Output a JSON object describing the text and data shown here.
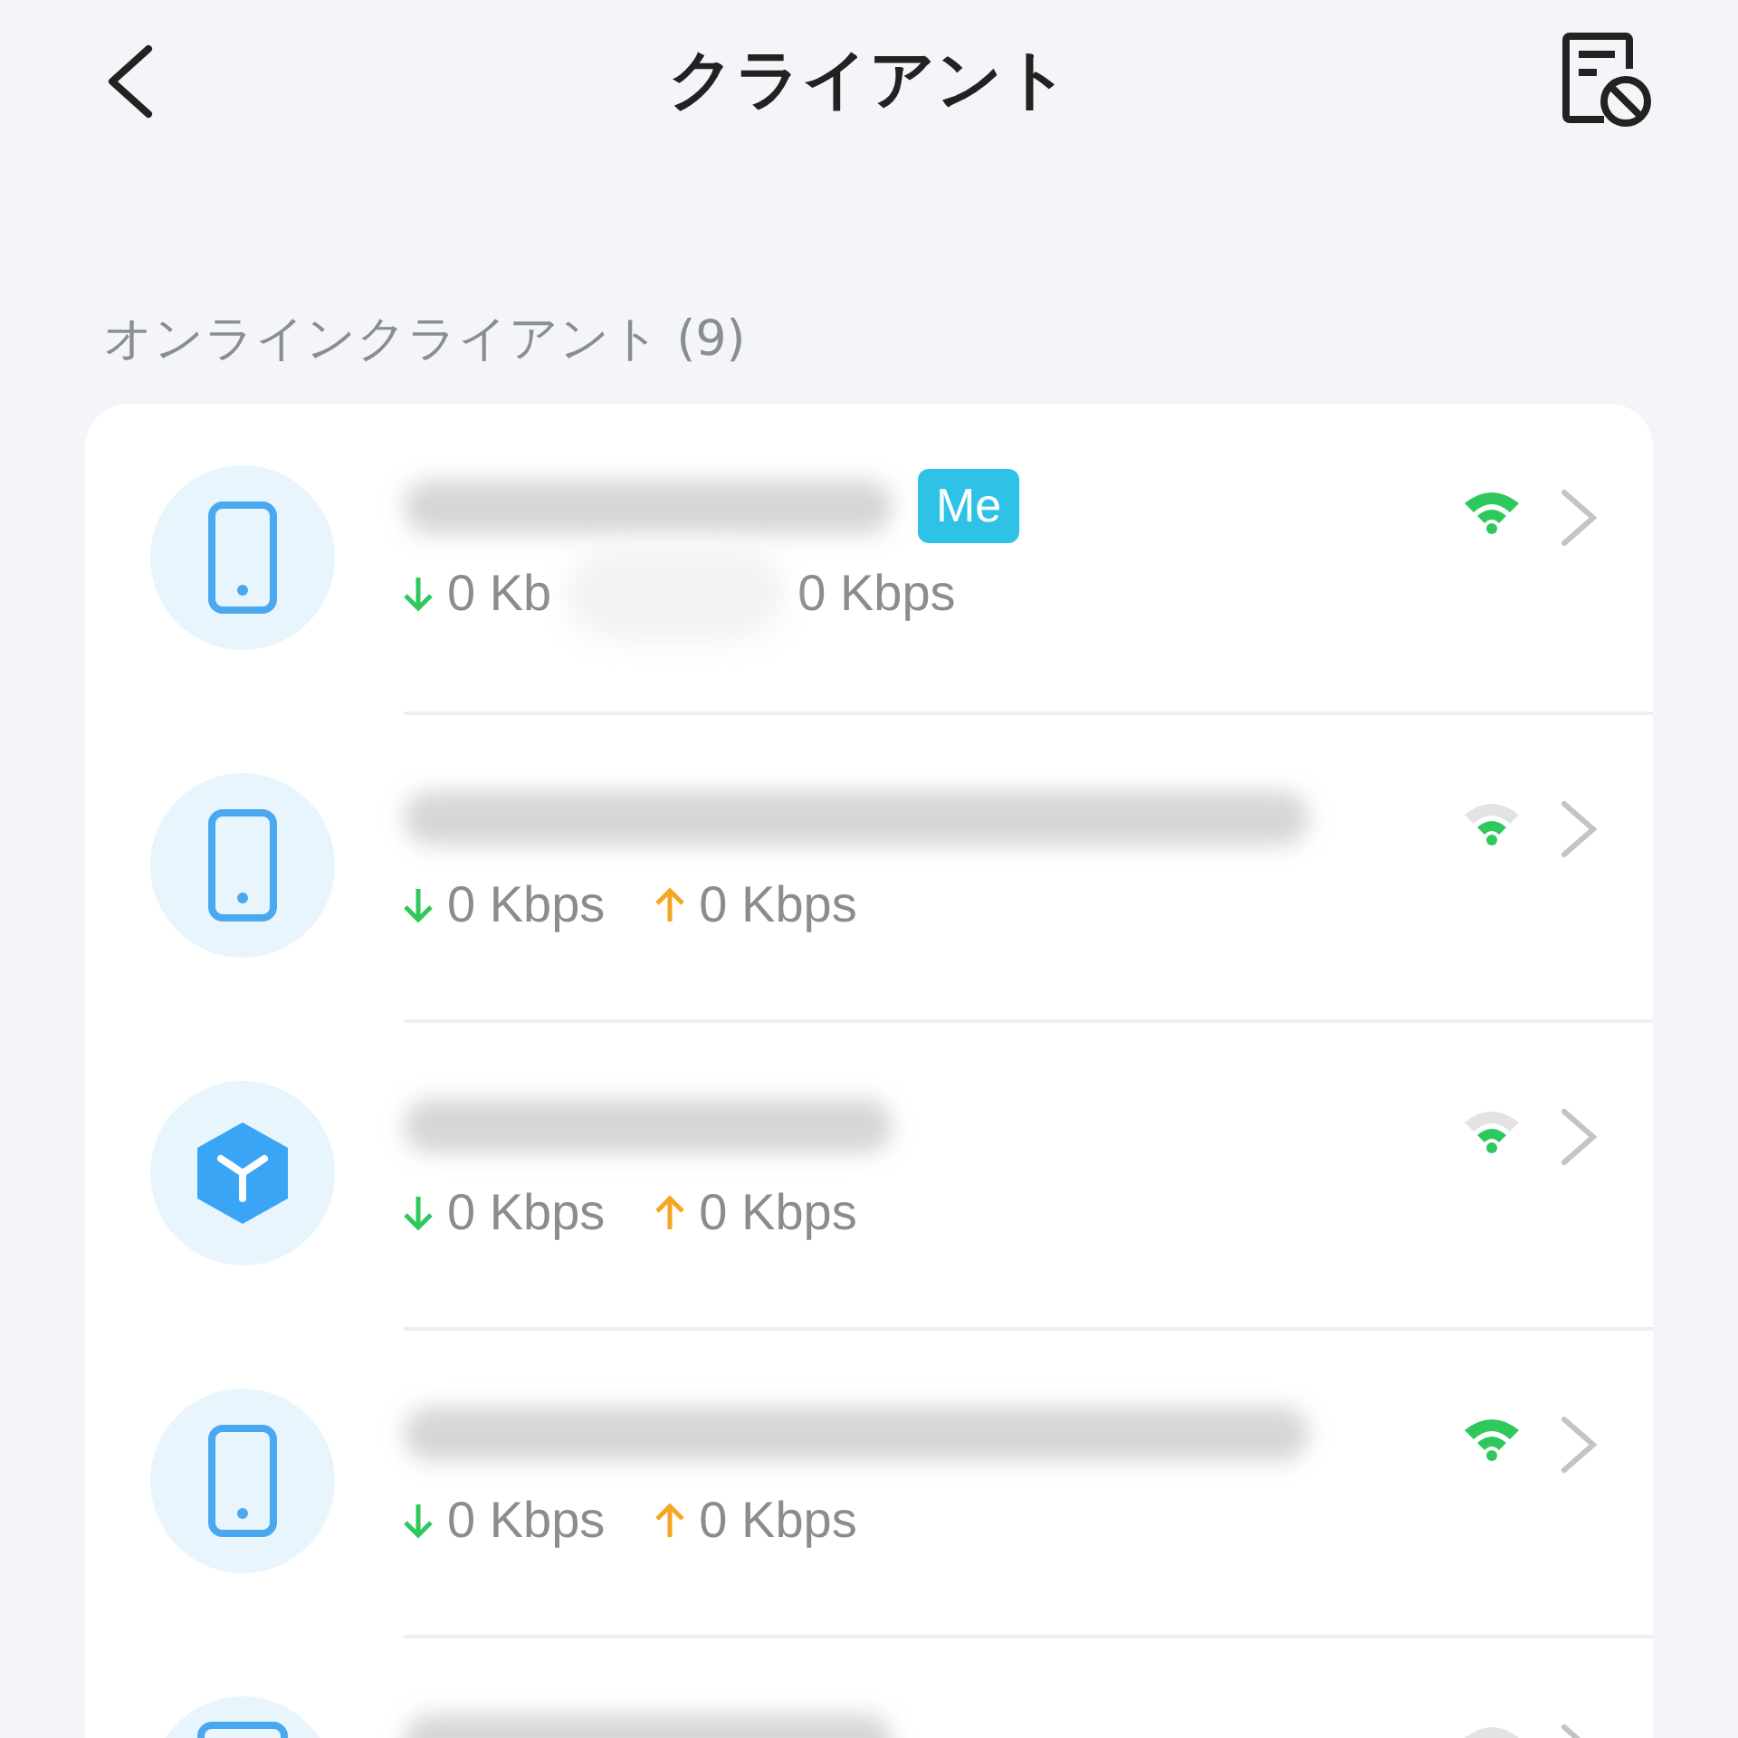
{
  "header": {
    "title": "クライアント"
  },
  "section": {
    "label": "オンラインクライアント (9)"
  },
  "clients": [
    {
      "kind": "phone",
      "long_name": false,
      "badge": "Me",
      "smudge": true,
      "down": "0 Kb",
      "up": "0 Kbps",
      "signal_full": true
    },
    {
      "kind": "phone",
      "long_name": true,
      "smudge": false,
      "down": "0 Kbps",
      "up": "0 Kbps",
      "signal_full": false
    },
    {
      "kind": "box",
      "long_name": false,
      "smudge": false,
      "down": "0 Kbps",
      "up": "0 Kbps",
      "signal_full": false
    },
    {
      "kind": "phone",
      "long_name": true,
      "smudge": false,
      "down": "0 Kbps",
      "up": "0 Kbps",
      "signal_full": true
    },
    {
      "kind": "tablet",
      "long_name": false,
      "signal_full": false
    }
  ]
}
